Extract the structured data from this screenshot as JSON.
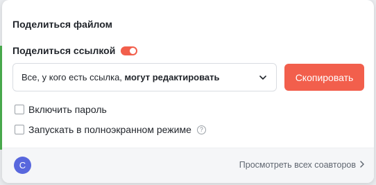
{
  "dialog": {
    "title": "Поделиться файлом"
  },
  "share_link": {
    "label": "Поделиться ссылкой",
    "toggle_on": true,
    "accent_color": "#f25f4c"
  },
  "access_select": {
    "value_prefix": "Все, у кого есть ссылка, ",
    "value_rest": "могут редактировать",
    "icon": "chevron-down-icon"
  },
  "copy_button": {
    "label": "Скопировать"
  },
  "options": {
    "password_label": "Включить пароль",
    "password_checked": false,
    "fullscreen_label": "Запускать в полноэкранном режиме",
    "fullscreen_checked": false,
    "help_glyph": "?"
  },
  "footer": {
    "avatar_letter": "С",
    "avatar_color": "#5867dd",
    "view_coauthors_label": "Просмотреть всех соавторов"
  }
}
